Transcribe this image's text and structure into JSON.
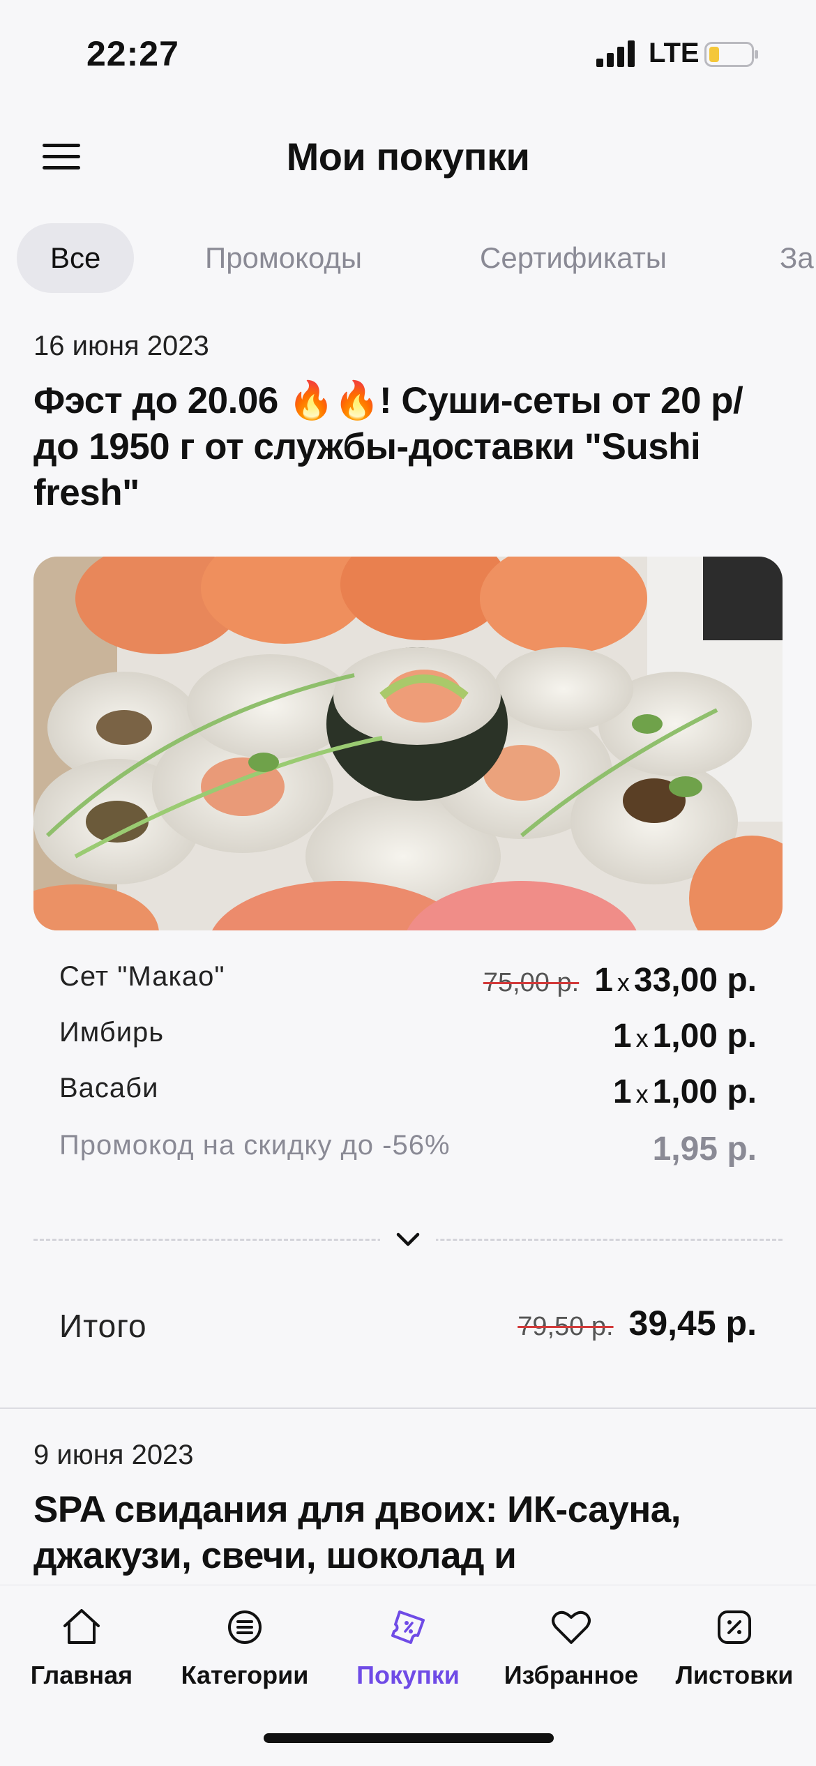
{
  "status_bar": {
    "time": "22:27",
    "network": "LTE"
  },
  "header": {
    "title": "Мои покупки"
  },
  "tabs": [
    {
      "label": "Все"
    },
    {
      "label": "Промокоды"
    },
    {
      "label": "Сертификаты"
    },
    {
      "label": "За"
    }
  ],
  "purchases": [
    {
      "date": "16 июня 2023",
      "title": "Фэст до 20.06 🔥🔥! Суши-сеты от 20 р/до 1950 г от службы-доставки \"Sushi fresh\"",
      "items": [
        {
          "name": "Сет \"Макао\"",
          "old_price": "75,00 р.",
          "qty": "1",
          "x": "x",
          "price": "33,00 р."
        },
        {
          "name": "Имбирь",
          "qty": "1",
          "x": "x",
          "price": "1,00 р."
        },
        {
          "name": "Васаби",
          "qty": "1",
          "x": "x",
          "price": "1,00 р."
        }
      ],
      "promo": {
        "name": "Промокод на скидку до -56%",
        "price": "1,95 р."
      },
      "total": {
        "label": "Итого",
        "old_price": "79,50 р.",
        "price": "39,45 р."
      }
    },
    {
      "date": "9 июня 2023",
      "title": "SPA свидания для двоих: ИК-сауна, джакузи, свечи, шоколад и"
    }
  ],
  "tabbar": [
    {
      "label": "Главная",
      "icon": "home-icon"
    },
    {
      "label": "Категории",
      "icon": "list-icon"
    },
    {
      "label": "Покупки",
      "icon": "ticket-icon",
      "active": true
    },
    {
      "label": "Избранное",
      "icon": "heart-icon"
    },
    {
      "label": "Листовки",
      "icon": "percent-icon"
    }
  ],
  "colors": {
    "accent": "#6f4be6",
    "strike": "#d23a3a",
    "muted": "#8a8a95",
    "background": "#f7f7f9"
  }
}
